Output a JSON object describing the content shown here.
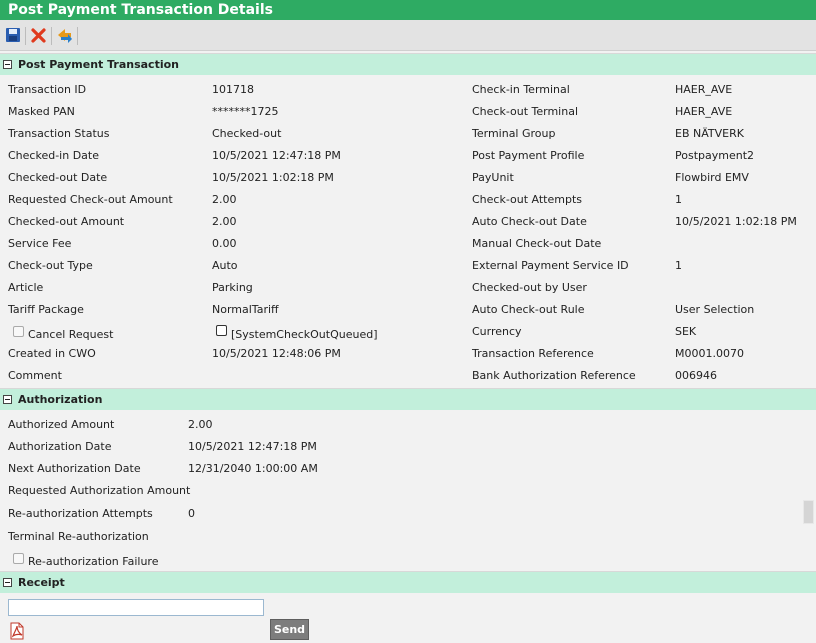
{
  "page_title": "Post Payment Transaction Details",
  "toolbar": {
    "save": "save-icon",
    "delete": "delete-icon",
    "refresh": "transfer-icon"
  },
  "sections": {
    "transaction": {
      "title": "Post Payment Transaction",
      "left": [
        {
          "label": "Transaction ID",
          "value": "101718"
        },
        {
          "label": "Masked PAN",
          "value": "*******1725"
        },
        {
          "label": "Transaction Status",
          "value": "Checked-out"
        },
        {
          "label": "Checked-in Date",
          "value": "10/5/2021 12:47:18 PM"
        },
        {
          "label": "Checked-out Date",
          "value": "10/5/2021 1:02:18 PM"
        },
        {
          "label": "Requested Check-out Amount",
          "value": "2.00"
        },
        {
          "label": "Checked-out Amount",
          "value": "2.00"
        },
        {
          "label": "Service Fee",
          "value": "0.00"
        },
        {
          "label": "Check-out Type",
          "value": "Auto"
        },
        {
          "label": "Article",
          "value": "Parking"
        },
        {
          "label": "Tariff Package",
          "value": "NormalTariff"
        },
        {
          "label": "Created in CWO",
          "value": "10/5/2021 12:48:06 PM"
        },
        {
          "label": "Comment",
          "value": ""
        }
      ],
      "cancel_request": "Cancel Request",
      "system_checkout_queued": "[SystemCheckOutQueued]",
      "right": [
        {
          "label": "Check-in Terminal",
          "value": "HAER_AVE"
        },
        {
          "label": "Check-out Terminal",
          "value": "HAER_AVE"
        },
        {
          "label": "Terminal Group",
          "value": "EB NÄTVERK"
        },
        {
          "label": "Post Payment Profile",
          "value": "Postpayment2"
        },
        {
          "label": "PayUnit",
          "value": "Flowbird EMV"
        },
        {
          "label": "Check-out Attempts",
          "value": "1"
        },
        {
          "label": "Auto Check-out Date",
          "value": "10/5/2021 1:02:18 PM"
        },
        {
          "label": "Manual Check-out Date",
          "value": ""
        },
        {
          "label": "External Payment Service ID",
          "value": "1"
        },
        {
          "label": "Checked-out by User",
          "value": ""
        },
        {
          "label": "Auto Check-out Rule",
          "value": "User Selection"
        },
        {
          "label": "Currency",
          "value": "SEK"
        },
        {
          "label": "Transaction Reference",
          "value": "M0001.0070"
        },
        {
          "label": "Bank Authorization Reference",
          "value": "006946"
        }
      ]
    },
    "authorization": {
      "title": "Authorization",
      "rows": [
        {
          "label": "Authorized Amount",
          "value": "2.00"
        },
        {
          "label": "Authorization Date",
          "value": "10/5/2021 12:47:18 PM"
        },
        {
          "label": "Next Authorization Date",
          "value": "12/31/2040 1:00:00 AM"
        },
        {
          "label": "Requested Authorization Amount",
          "value": ""
        },
        {
          "label": "Re-authorization Attempts",
          "value": "0"
        },
        {
          "label": "Terminal Re-authorization",
          "value": ""
        }
      ],
      "reauth_failure": "Re-authorization Failure"
    },
    "receipt": {
      "title": "Receipt",
      "input_value": "",
      "send_label": "Send"
    }
  }
}
